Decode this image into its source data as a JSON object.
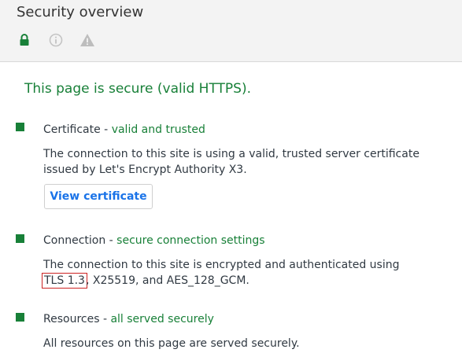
{
  "header": {
    "title": "Security overview",
    "icons": [
      "lock-icon",
      "info-icon",
      "warning-icon"
    ]
  },
  "summary": "This page is secure (valid HTTPS).",
  "sections": [
    {
      "label": "Certificate",
      "separator": " - ",
      "status": "valid and trusted",
      "description": "The connection to this site is using a valid, trusted server certificate issued by Let's Encrypt Authority X3.",
      "button_label": "View certificate"
    },
    {
      "label": "Connection",
      "separator": " - ",
      "status": "secure connection settings",
      "description_before": "The connection to this site is encrypted and authenticated using ",
      "description_highlight": "TLS 1.3",
      "description_after": ", X25519, and AES_128_GCM."
    },
    {
      "label": "Resources",
      "separator": " - ",
      "status": "all served securely",
      "description": "All resources on this page are served securely."
    }
  ],
  "colors": {
    "secure_green": "#188038",
    "link_blue": "#1a73e8",
    "highlight_red": "#cc2222"
  }
}
